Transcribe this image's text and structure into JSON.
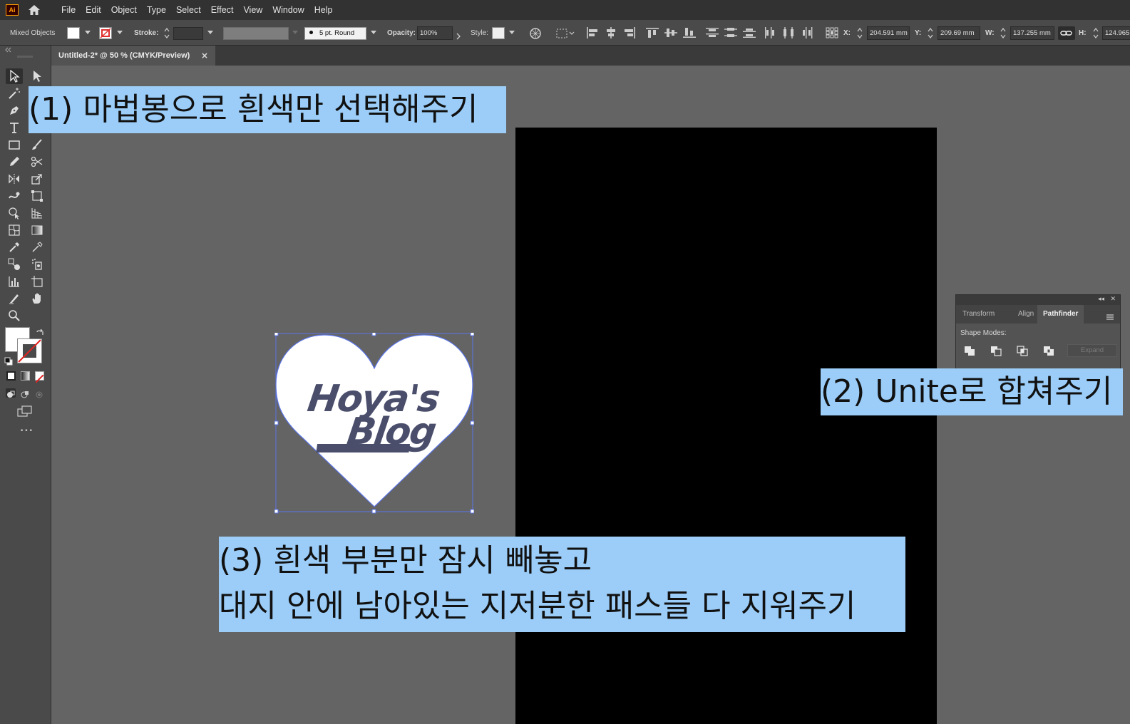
{
  "app": {
    "logo_text": "Ai",
    "brand_color": "#ff9a00"
  },
  "menu": {
    "items": [
      "File",
      "Edit",
      "Object",
      "Type",
      "Select",
      "Effect",
      "View",
      "Window",
      "Help"
    ]
  },
  "control_bar": {
    "selection_type": "Mixed Objects",
    "stroke_label": "Stroke:",
    "brush_value": "5 pt. Round",
    "opacity_label": "Opacity:",
    "opacity_value": "100%",
    "style_label": "Style:",
    "x_label": "X:",
    "x_value": "204.591 mm",
    "y_label": "Y:",
    "y_value": "209.69 mm",
    "w_label": "W:",
    "w_value": "137.255 mm",
    "h_label": "H:",
    "h_value": "124.965"
  },
  "document": {
    "tab_title": "Untitled-2* @ 50 % (CMYK/Preview)",
    "close_glyph": "×"
  },
  "artwork": {
    "logo_line1": "Hoya's",
    "logo_line2": "Blog",
    "artboard_color": "#000000",
    "heart_color": "#ffffff",
    "logo_color": "#4a4e6b",
    "selection_color": "#5a74e6"
  },
  "annotations": {
    "step1": "(1) 마법봉으로 흰색만 선택해주기",
    "step2": "(2) Unite로 합쳐주기",
    "step3_line1": "(3) 흰색 부분만 잠시 빼놓고",
    "step3_line2": "대지 안에 남아있는 지저분한 패스들 다 지워주기",
    "highlight_color": "#9bcdf8"
  },
  "pathfinder_panel": {
    "collapse_glyph": "◂◂",
    "close_glyph": "✕",
    "tabs": [
      "Transform",
      "Align",
      "Pathfinder"
    ],
    "active_tab": "Pathfinder",
    "shape_modes_label": "Shape Modes:",
    "expand_label": "Expand"
  },
  "toolbar": {
    "more_glyph": "•••"
  }
}
